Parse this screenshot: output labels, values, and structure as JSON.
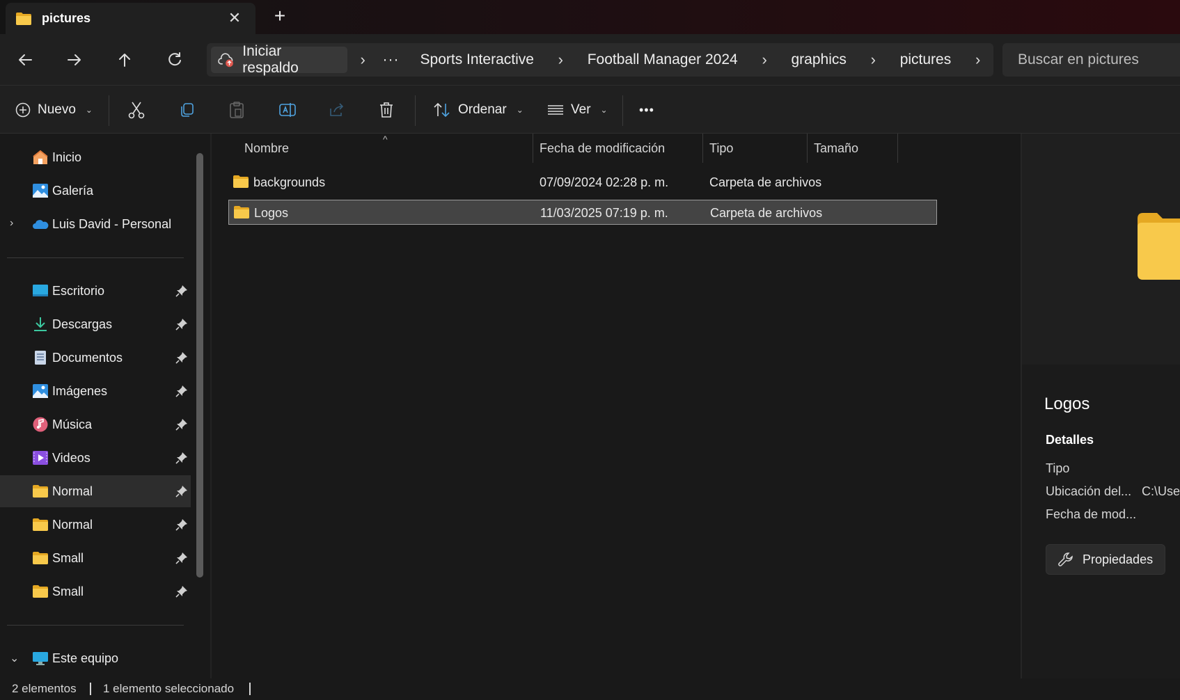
{
  "colors": {
    "folder": "#F8C94B",
    "folder_dark": "#E5A823",
    "selection_bg": "#444444",
    "text": "#E8E8E8"
  },
  "tab": {
    "title": "pictures",
    "folder_icon": "folder-icon",
    "close_icon": "close-icon",
    "new_tab_icon": "plus-icon"
  },
  "nav": {
    "back_icon": "arrow-left-icon",
    "forward_icon": "arrow-right-icon",
    "up_icon": "arrow-up-icon",
    "refresh_icon": "refresh-icon",
    "backup_label": "Iniciar respaldo",
    "overflow": "···",
    "breadcrumbs": [
      "Sports Interactive",
      "Football Manager 2024",
      "graphics",
      "pictures"
    ],
    "search_placeholder": "Buscar en pictures"
  },
  "commands": {
    "new_label": "Nuevo",
    "sort_label": "Ordenar",
    "view_label": "Ver",
    "more": "•••"
  },
  "sidebar": {
    "top": [
      {
        "label": "Inicio",
        "icon": "home-icon"
      },
      {
        "label": "Galería",
        "icon": "gallery-icon"
      },
      {
        "label": "Luis David - Personal",
        "icon": "onedrive-cloud-icon"
      }
    ],
    "pinned": [
      {
        "label": "Escritorio",
        "icon": "desktop-icon"
      },
      {
        "label": "Descargas",
        "icon": "download-icon"
      },
      {
        "label": "Documentos",
        "icon": "document-icon"
      },
      {
        "label": "Imágenes",
        "icon": "pictures-icon"
      },
      {
        "label": "Música",
        "icon": "music-icon"
      },
      {
        "label": "Videos",
        "icon": "videos-icon"
      },
      {
        "label": "Normal",
        "icon": "folder-icon"
      },
      {
        "label": "Normal",
        "icon": "folder-icon"
      },
      {
        "label": "Small",
        "icon": "folder-icon"
      },
      {
        "label": "Small",
        "icon": "folder-icon"
      }
    ],
    "this_pc": {
      "label": "Este equipo",
      "icon": "computer-icon"
    }
  },
  "filelist": {
    "columns": [
      "Nombre",
      "Fecha de modificación",
      "Tipo",
      "Tamaño"
    ],
    "rows": [
      {
        "name": "backgrounds",
        "modified": "07/09/2024 02:28 p. m.",
        "type": "Carpeta de archivos",
        "size": "",
        "selected": false
      },
      {
        "name": "Logos",
        "modified": "11/03/2025 07:19 p. m.",
        "type": "Carpeta de archivos",
        "size": "",
        "selected": true
      }
    ]
  },
  "details": {
    "title": "Logos",
    "section": "Detalles",
    "fields": [
      {
        "label": "Tipo",
        "value": ""
      },
      {
        "label": "Ubicación del...",
        "value": "C:\\User"
      },
      {
        "label": "Fecha de mod...",
        "value": ""
      }
    ],
    "properties_label": "Propiedades"
  },
  "status": {
    "count": "2 elementos",
    "selection": "1 elemento seleccionado"
  }
}
